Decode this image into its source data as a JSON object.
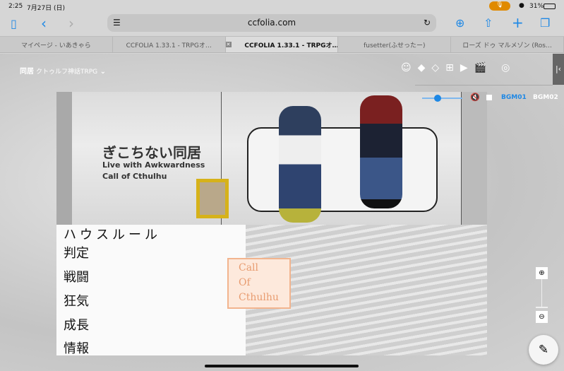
{
  "status": {
    "time": "2:25",
    "date": "7月27日 (日)",
    "battery": "31%"
  },
  "browser": {
    "url": "ccfolia.com",
    "tabs": [
      {
        "label": "マイページ - いあきゃら",
        "active": false
      },
      {
        "label": "CCFOLIA 1.33.1 - TRPGオ…",
        "active": false
      },
      {
        "label": "CCFOLIA 1.33.1 - TRPGオ…",
        "active": true
      },
      {
        "label": "fusetter(ふせったー)",
        "active": false
      },
      {
        "label": "ローズ ドゥ マルメゾン (Ros…",
        "active": false
      }
    ]
  },
  "room": {
    "title": "同居",
    "subtitle": "クトゥルフ神話TRPG"
  },
  "audio": {
    "volume": 0.4,
    "bgm1": "BGM01",
    "bgm2": "BGM02"
  },
  "board": {
    "title_jp": "ぎこちない同居",
    "title_en": "Live with Awkwardness",
    "system": "Call of Cthulhu",
    "rules_heading": "ハウスルール",
    "rules": [
      "判定",
      "戦闘",
      "狂気",
      "成長",
      "情報"
    ],
    "card": [
      "Call",
      "Of",
      "Cthulhu"
    ]
  },
  "accent": "#1e88e5"
}
